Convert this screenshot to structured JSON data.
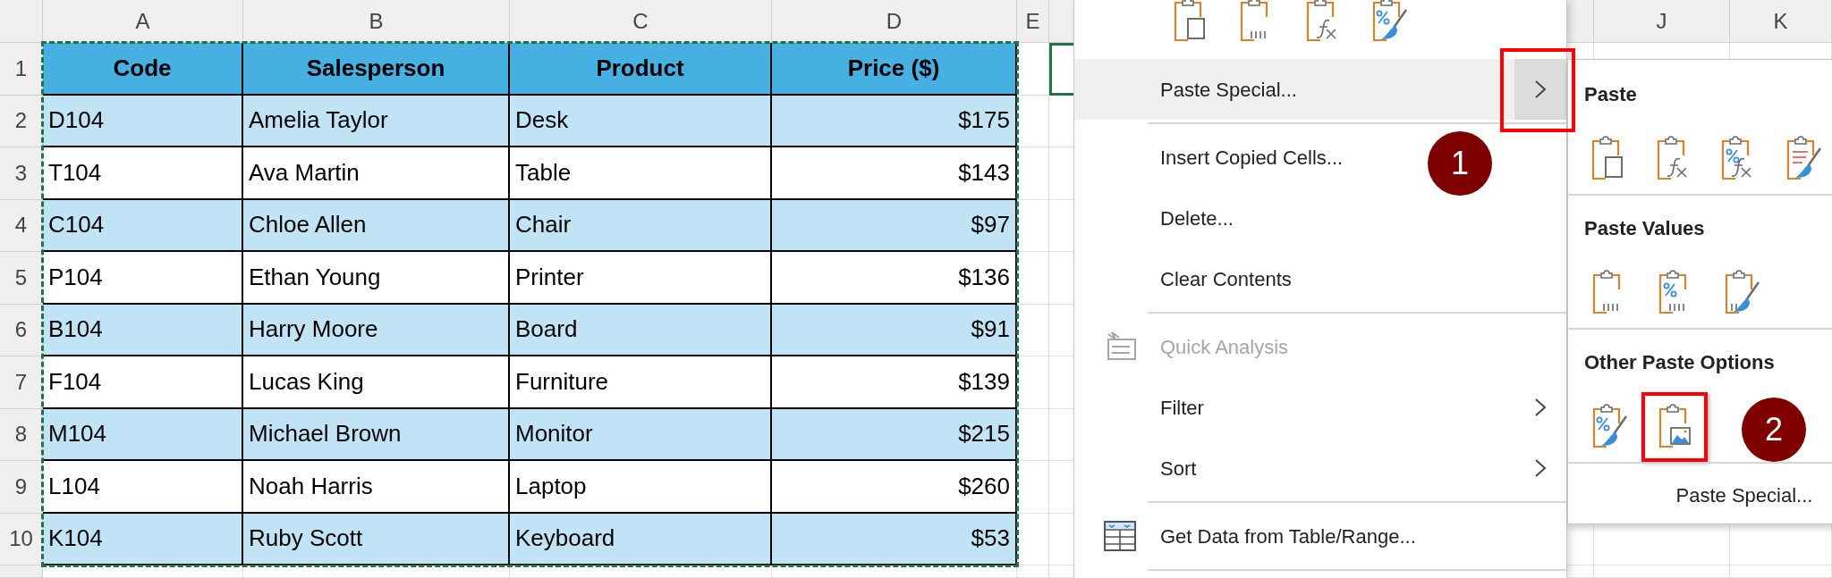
{
  "sheet": {
    "column_headers": [
      "A",
      "B",
      "C",
      "D",
      "E"
    ],
    "row_headers": [
      "1",
      "2",
      "3",
      "4",
      "5",
      "6",
      "7",
      "8",
      "9",
      "10"
    ],
    "background_column_headers": [
      "J",
      "K"
    ],
    "active_cell_outline": true
  },
  "table": {
    "banded": true,
    "copy_marquee": true,
    "columns": [
      "Code",
      "Salesperson",
      "Product",
      "Price ($)"
    ],
    "rows": [
      [
        "D104",
        "Amelia Taylor",
        "Desk",
        "$175"
      ],
      [
        "T104",
        "Ava Martin",
        "Table",
        "$143"
      ],
      [
        "C104",
        "Chloe Allen",
        "Chair",
        "$97"
      ],
      [
        "P104",
        "Ethan Young",
        "Printer",
        "$136"
      ],
      [
        "B104",
        "Harry Moore",
        "Board",
        "$91"
      ],
      [
        "F104",
        "Lucas King",
        "Furniture",
        "$139"
      ],
      [
        "M104",
        "Michael Brown",
        "Monitor",
        "$215"
      ],
      [
        "L104",
        "Noah Harris",
        "Laptop",
        "$260"
      ],
      [
        "K104",
        "Ruby Scott",
        "Keyboard",
        "$53"
      ]
    ]
  },
  "context_menu": {
    "paste_options": [
      {
        "marked": false
      },
      {
        "marked": false
      },
      {
        "marked": false
      },
      {
        "marked": false
      }
    ],
    "items": [
      {
        "label": "Paste Special...",
        "highlighted": true,
        "submenu": true,
        "marked": true,
        "disabled": false,
        "has_icon": false,
        "separator_after": true
      },
      {
        "label": "Insert Copied Cells...",
        "highlighted": false,
        "submenu": false,
        "marked": false,
        "disabled": false,
        "has_icon": false,
        "separator_after": false
      },
      {
        "label": "Delete...",
        "highlighted": false,
        "submenu": false,
        "marked": false,
        "disabled": false,
        "has_icon": false,
        "separator_after": false
      },
      {
        "label": "Clear Contents",
        "highlighted": false,
        "submenu": false,
        "marked": false,
        "disabled": false,
        "has_icon": false,
        "separator_after": true
      },
      {
        "label": "Quick Analysis",
        "highlighted": false,
        "submenu": false,
        "marked": false,
        "disabled": true,
        "has_icon": true,
        "separator_after": false
      },
      {
        "label": "Filter",
        "highlighted": false,
        "submenu": true,
        "marked": false,
        "disabled": false,
        "has_icon": false,
        "separator_after": false
      },
      {
        "label": "Sort",
        "highlighted": false,
        "submenu": true,
        "marked": false,
        "disabled": false,
        "has_icon": false,
        "separator_after": true
      },
      {
        "label": "Get Data from Table/Range...",
        "highlighted": false,
        "submenu": false,
        "marked": false,
        "disabled": false,
        "has_icon": true,
        "separator_after": true
      }
    ]
  },
  "paste_submenu": {
    "sections": [
      {
        "heading": "Paste",
        "options": [
          {
            "marked": false
          },
          {
            "marked": false
          },
          {
            "marked": false
          },
          {
            "marked": false
          }
        ]
      },
      {
        "heading": "Paste Values",
        "options": [
          {
            "marked": false
          },
          {
            "marked": false
          },
          {
            "marked": false
          }
        ]
      },
      {
        "heading": "Other Paste Options",
        "options": [
          {
            "marked": false
          },
          {
            "marked": true
          }
        ]
      }
    ],
    "footer": "Paste Special..."
  },
  "callouts": [
    {
      "text": "1"
    },
    {
      "text": "2"
    }
  ]
}
